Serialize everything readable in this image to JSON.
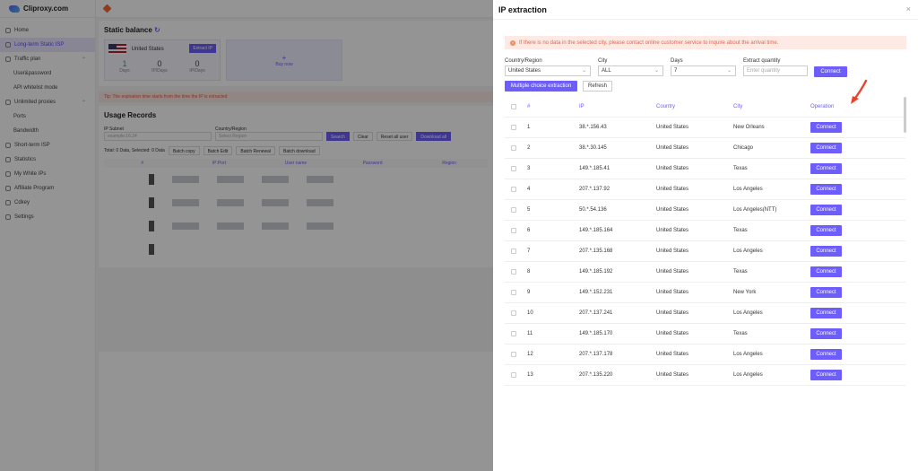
{
  "app": {
    "brand": "Cliproxy.com",
    "sidebar": [
      {
        "label": "Home",
        "type": "top"
      },
      {
        "label": "Long-term Static ISP",
        "type": "top",
        "active": true
      },
      {
        "label": "Traffic plan",
        "type": "top",
        "expand": true
      },
      {
        "label": "User&password",
        "type": "sub"
      },
      {
        "label": "API whitelist mode",
        "type": "sub"
      },
      {
        "label": "Unlimited proxies",
        "type": "top",
        "expand": true
      },
      {
        "label": "Ports",
        "type": "sub"
      },
      {
        "label": "Bandwidth",
        "type": "sub"
      },
      {
        "label": "Short-term ISP",
        "type": "top"
      },
      {
        "label": "Statistics",
        "type": "top"
      },
      {
        "label": "My White IPs",
        "type": "top"
      },
      {
        "label": "Affiliate Program",
        "type": "top"
      },
      {
        "label": "Cdkey",
        "type": "top"
      },
      {
        "label": "Settings",
        "type": "top"
      }
    ],
    "static_balance_title": "Static balance",
    "balance_card": {
      "country": "United States",
      "extract_btn": "Extract IP",
      "n1": "1",
      "l1": "Days",
      "n2": "0",
      "l2": "IP/Days",
      "n3": "0",
      "l3": "IP/Days"
    },
    "buy_now": "Buy now",
    "buy_plus": "+",
    "tip": "Tip: The expiration time starts from the time the IP is extracted",
    "usage_title": "Usage Records",
    "ip_subnet_label": "IP Subnet",
    "ip_subnet_placeholder": "example:16.24",
    "country_label": "Country/Region",
    "select_region": "Select Region",
    "search": "Search",
    "clear": "Clear",
    "reset": "Reset all user",
    "download": "Download all",
    "total": "Total: 0 Data, Selected: 0 Data",
    "batch_copy": "Batch copy",
    "batch_edit": "Batch Edit",
    "batch_renewal": "Batch Renewal",
    "batch_download": "Batch download",
    "cols": [
      "#",
      "IP:Port",
      "User name",
      "Password",
      "Region"
    ]
  },
  "drawer": {
    "title": "IP extraction",
    "close_icon": "×",
    "notice": "If there is no data in the selected city, please contact online customer service to inquire about the arrival time.",
    "notice_icon": "!",
    "country_label": "Country/Region",
    "country_value": "United States",
    "city_label": "City",
    "city_value": "ALL",
    "days_label": "Days",
    "days_value": "7",
    "qty_label": "Extract quantity",
    "qty_placeholder": "Enter quantity",
    "connect_btn": "Connect",
    "multi_btn": "Multiple choice extraction",
    "refresh_btn": "Refresh",
    "chevron": "⌄",
    "columns": {
      "num": "#",
      "ip": "IP",
      "country": "Country",
      "city": "City",
      "op": "Operation"
    },
    "row_action": "Connect",
    "rows": [
      {
        "num": "1",
        "ip": "38.*.156.43",
        "country": "United States",
        "city": "New Orleans"
      },
      {
        "num": "2",
        "ip": "38.*.30.145",
        "country": "United States",
        "city": "Chicago"
      },
      {
        "num": "3",
        "ip": "149.*.185.41",
        "country": "United States",
        "city": "Texas"
      },
      {
        "num": "4",
        "ip": "207.*.137.92",
        "country": "United States",
        "city": "Los Angeles"
      },
      {
        "num": "5",
        "ip": "50.*.54.136",
        "country": "United States",
        "city": "Los Angeles(NTT)"
      },
      {
        "num": "6",
        "ip": "149.*.185.164",
        "country": "United States",
        "city": "Texas"
      },
      {
        "num": "7",
        "ip": "207.*.135.168",
        "country": "United States",
        "city": "Los Angeles"
      },
      {
        "num": "8",
        "ip": "149.*.185.192",
        "country": "United States",
        "city": "Texas"
      },
      {
        "num": "9",
        "ip": "149.*.152.231",
        "country": "United States",
        "city": "New York"
      },
      {
        "num": "10",
        "ip": "207.*.137.241",
        "country": "United States",
        "city": "Los Angeles"
      },
      {
        "num": "11",
        "ip": "149.*.185.170",
        "country": "United States",
        "city": "Texas"
      },
      {
        "num": "12",
        "ip": "207.*.137.178",
        "country": "United States",
        "city": "Los Angeles"
      },
      {
        "num": "13",
        "ip": "207.*.135.220",
        "country": "United States",
        "city": "Los Angeles"
      }
    ]
  },
  "colors": {
    "accent": "#6d5dfc",
    "notice_bg": "#fdeae5",
    "notice_text": "#e2674a",
    "arrow": "#e8442a"
  }
}
